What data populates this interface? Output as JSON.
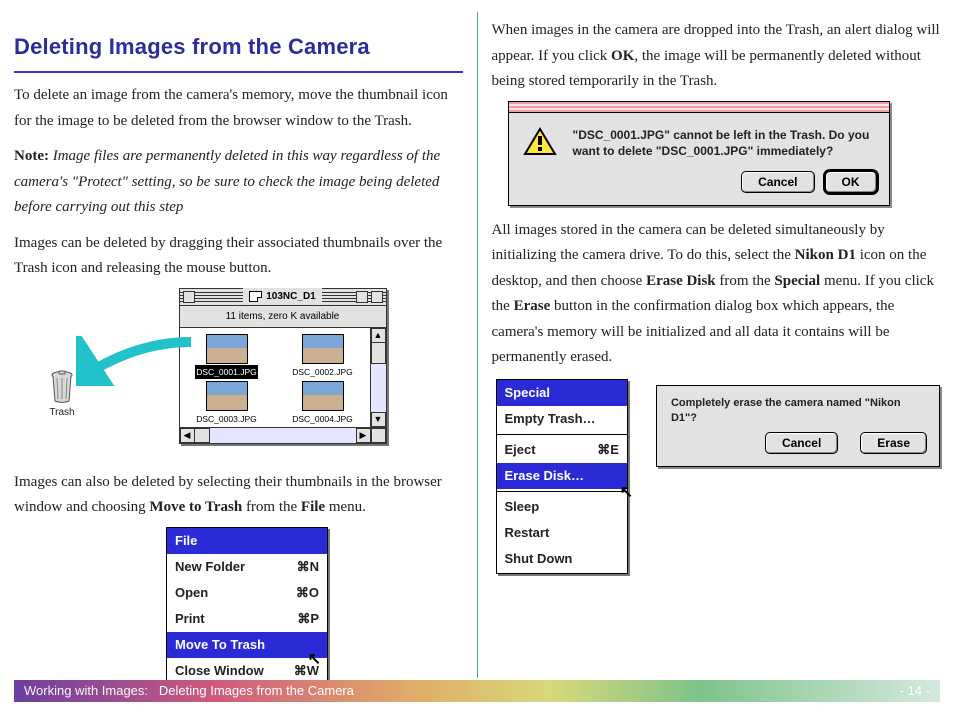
{
  "title": "Deleting Images from the Camera",
  "intro": "To delete an image from the camera's memory, move the thumbnail icon for the image to be deleted from the browser window to the Trash.",
  "note": {
    "label": "Note:",
    "body": "Image files are permanently deleted in this way regardless of the camera's \"Protect\" setting, so be sure to check the image being deleted before carrying out this step"
  },
  "para_drag": "Images can be deleted by dragging their associated thumbnails over the Trash icon and releasing the mouse button.",
  "browser": {
    "title": "103NC_D1",
    "status": "11 items, zero K available",
    "thumbs": [
      "DSC_0001.JPG",
      "DSC_0002.JPG",
      "DSC_0003.JPG",
      "DSC_0004.JPG"
    ]
  },
  "trash_label": "Trash",
  "para_menu_a": "Images can also be deleted by selecting their thumbnails in the browser window and choosing ",
  "para_menu_b": "Move to Trash",
  "para_menu_c": " from the ",
  "para_menu_d": "File",
  "para_menu_e": " menu.",
  "file_menu": {
    "title": "File",
    "items": [
      {
        "label": "New Folder",
        "short": "⌘N"
      },
      {
        "label": "Open",
        "short": "⌘O"
      },
      {
        "label": "Print",
        "short": "⌘P"
      },
      {
        "label": "Move To Trash",
        "short": ""
      },
      {
        "label": "Close Window",
        "short": "⌘W"
      }
    ]
  },
  "right_intro_a": "When images in the camera are dropped into the Trash, an alert dialog will appear. If you click ",
  "right_intro_b": "OK",
  "right_intro_c": ", the image will be permanently deleted without being stored temporarily in the Trash.",
  "alert1": {
    "text": "\"DSC_0001.JPG\" cannot be left in the Trash.  Do you want to delete \"DSC_0001.JPG\" immediately?",
    "cancel": "Cancel",
    "ok": "OK"
  },
  "right_para2_a": "All images stored in the camera can be deleted simultaneously by initializing the camera drive. To do this, select the ",
  "right_para2_b": "Nikon D1",
  "right_para2_c": " icon on the desktop, and then choose ",
  "right_para2_d": "Erase Disk",
  "right_para2_e": " from the ",
  "right_para2_f": "Special",
  "right_para2_g": " menu. If you click the ",
  "right_para2_h": "Erase",
  "right_para2_i": " button in the confirmation dialog box which appears, the camera's memory will be initialized and all data it contains will be permanently erased.",
  "special_menu": {
    "title": "Special",
    "items": [
      "Empty Trash…",
      "Eject",
      "Erase Disk…",
      "Sleep",
      "Restart",
      "Shut Down"
    ],
    "eject_short": "⌘E"
  },
  "alert2": {
    "text": "Completely erase the camera named \"Nikon D1\"?",
    "cancel": "Cancel",
    "erase": "Erase"
  },
  "footer": {
    "section": "Working with Images:",
    "subsection": "Deleting Images from the Camera",
    "page": "- 14 -"
  }
}
